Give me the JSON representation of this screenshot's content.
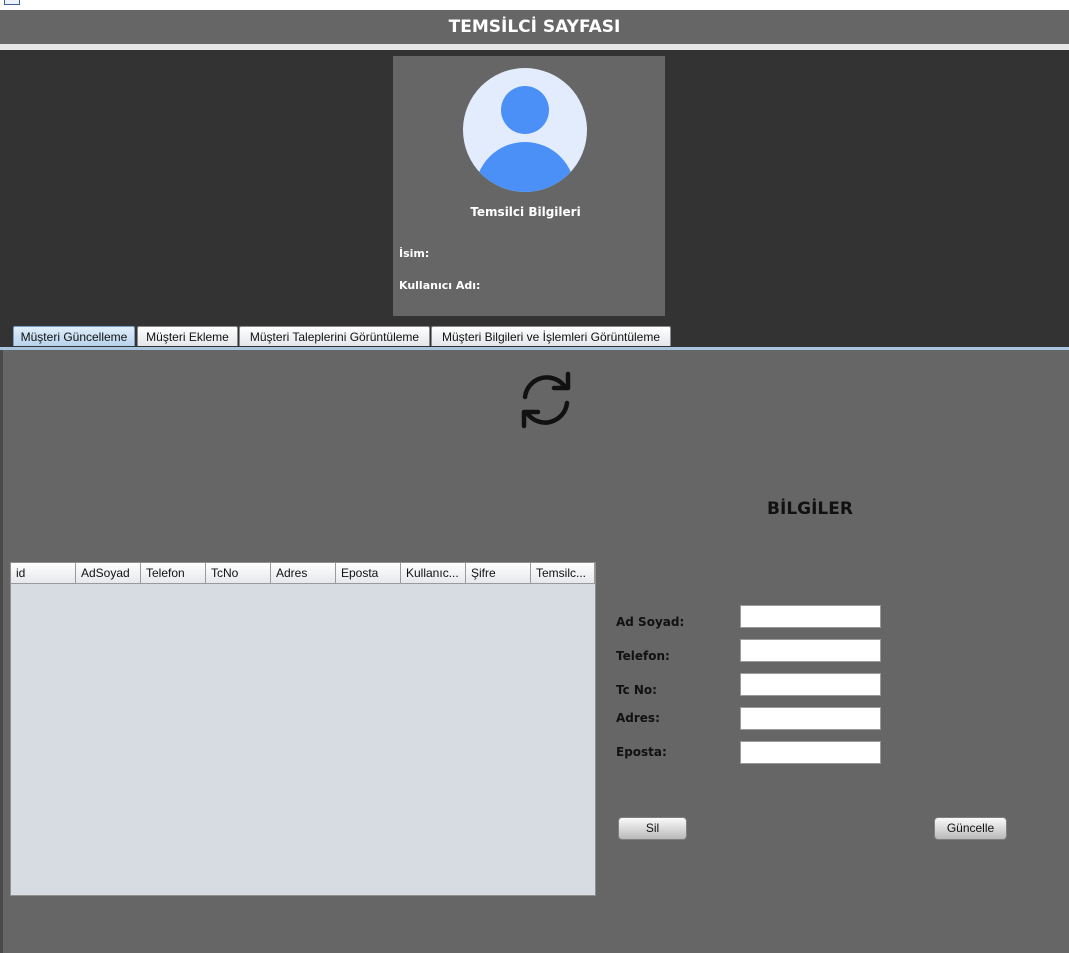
{
  "header": {
    "title": "TEMSİLCİ SAYFASI"
  },
  "profile": {
    "title": "Temsilci Bilgileri",
    "name_label": "İsim:",
    "username_label": "Kullanıcı Adı:",
    "avatar_icon": "user-avatar-icon"
  },
  "tabs": [
    {
      "label": "Müşteri Güncelleme",
      "active": true
    },
    {
      "label": "Müşteri Ekleme"
    },
    {
      "label": "Müşteri Taleplerini Görüntüleme"
    },
    {
      "label": "Müşteri Bilgileri ve İşlemleri Görüntüleme"
    }
  ],
  "main": {
    "refresh_icon": "refresh-icon",
    "section_title": "BİLGİLER",
    "table": {
      "columns": [
        "id",
        "AdSoyad",
        "Telefon",
        "TcNo",
        "Adres",
        "Eposta",
        "Kullanıc...",
        "Şifre",
        "Temsilc..."
      ],
      "rows": []
    },
    "form": {
      "fields": [
        {
          "label": "Ad Soyad:",
          "value": ""
        },
        {
          "label": "Telefon:",
          "value": ""
        },
        {
          "label": "Tc No:",
          "value": ""
        },
        {
          "label": "Adres:",
          "value": ""
        },
        {
          "label": "Eposta:",
          "value": ""
        }
      ],
      "delete_label": "Sil",
      "update_label": "Güncelle"
    }
  },
  "colors": {
    "header_bg": "#666666",
    "dark_bg": "#333333",
    "panel_bg": "#666666",
    "avatar_blue": "#4a90f7",
    "avatar_bg": "#e3ecfd",
    "table_bg": "#d7dbe2"
  }
}
